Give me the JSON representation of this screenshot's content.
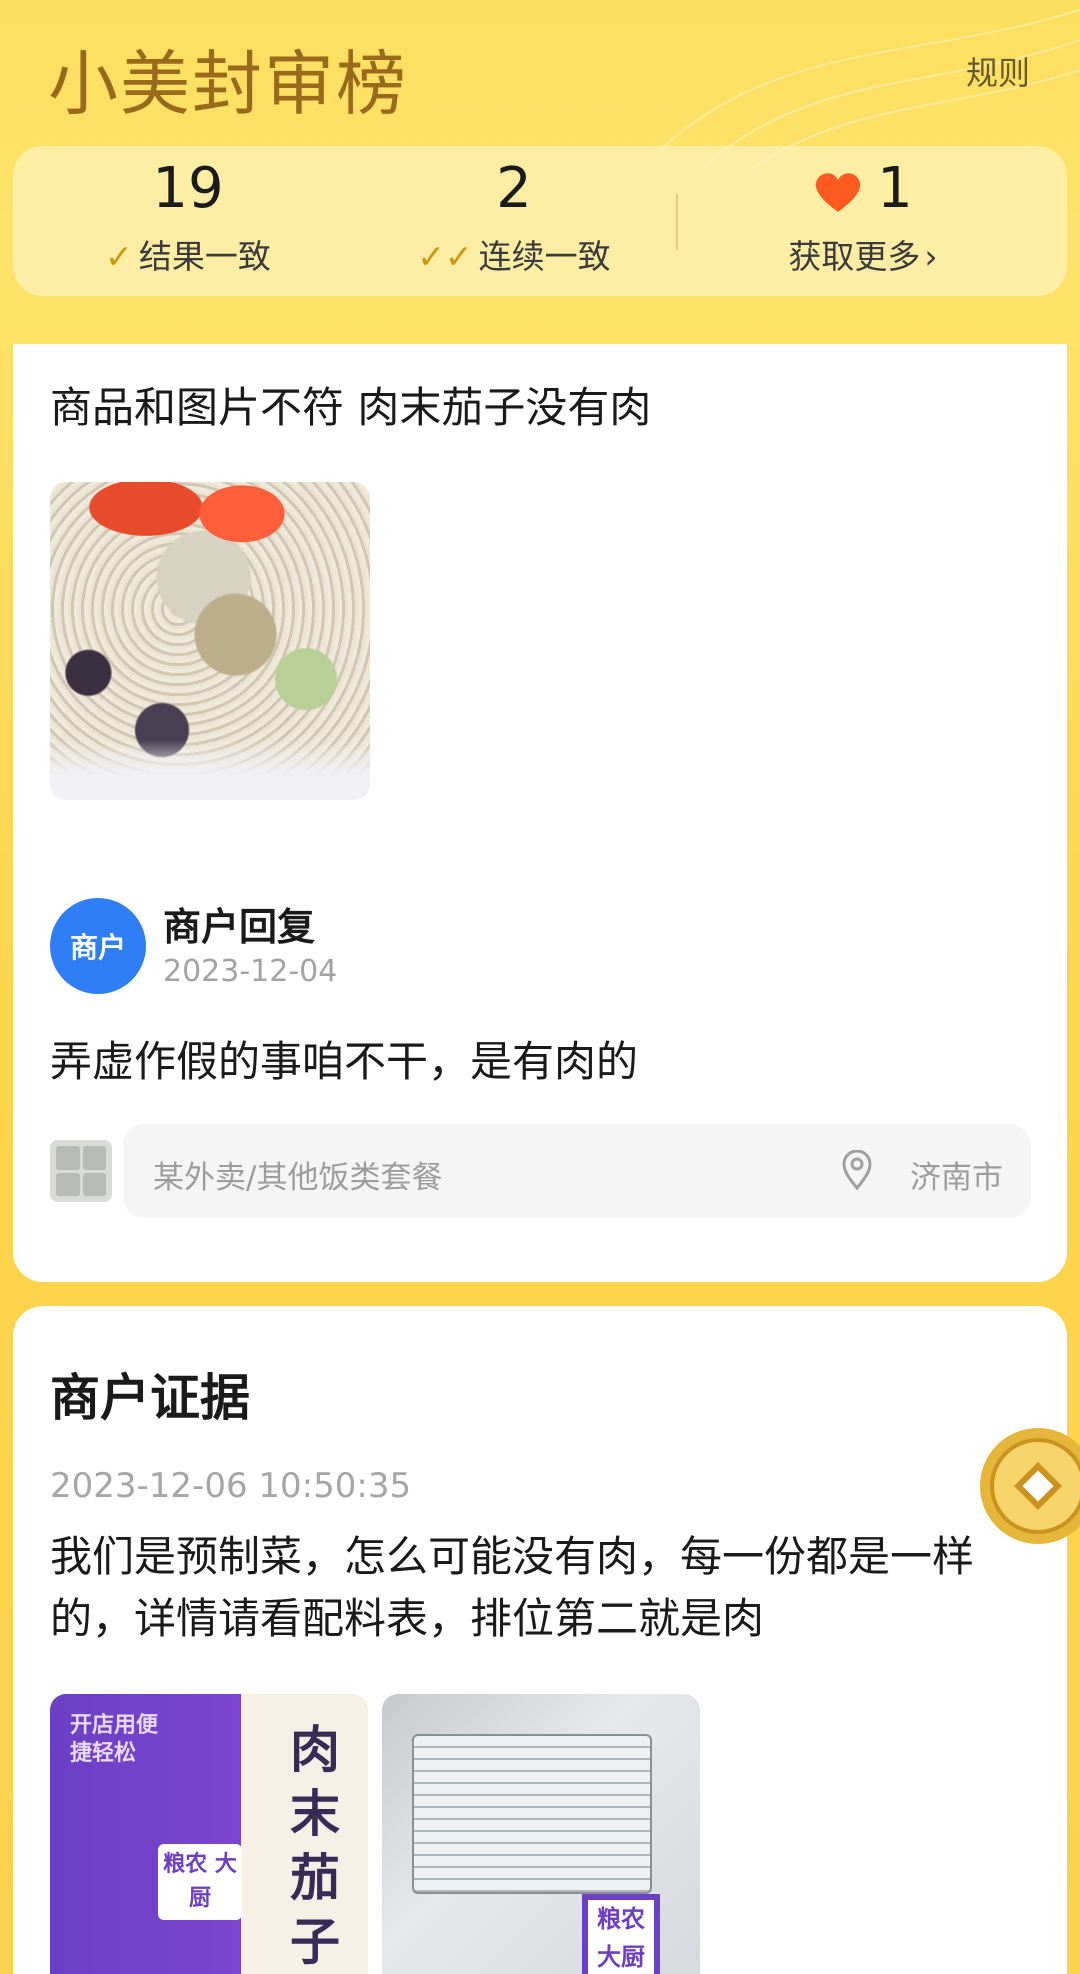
{
  "header": {
    "title": "小美封审榜",
    "rules_label": "规则"
  },
  "stats": {
    "consistent_count": "19",
    "consistent_label": "结果一致",
    "streak_count": "2",
    "streak_label": "连续一致",
    "hearts_count": "1",
    "more_label": "获取更多"
  },
  "case": {
    "complaint": "商品和图片不符 肉末茄子没有肉",
    "merchant_avatar_label": "商户",
    "reply_title": "商户回复",
    "reply_date": "2023-12-04",
    "reply_text": "弄虚作假的事咱不干，是有肉的",
    "category": "某外卖/其他饭类套餐",
    "location": "济南市"
  },
  "evidence": {
    "title": "商户证据",
    "timestamp": "2023-12-06 10:50:35",
    "text": "我们是预制菜，怎么可能没有肉，每一份都是一样的，详情请看配料表，排位第二就是肉",
    "package_text": "开店用便捷轻松",
    "package_title": "肉末茄子",
    "brand_logo": "粮农\n大厨"
  },
  "colors": {
    "brand_gold": "#9a6a1c",
    "accent_heart": "#ff5a1f",
    "merchant_blue": "#2f7ef5",
    "check_gold": "#c89a10"
  },
  "icons": {
    "check": "check-icon",
    "double_check": "double-check-icon",
    "heart": "heart-icon",
    "chevron": "chevron-right-icon",
    "location": "location-pin-icon",
    "coin": "coin-icon"
  }
}
